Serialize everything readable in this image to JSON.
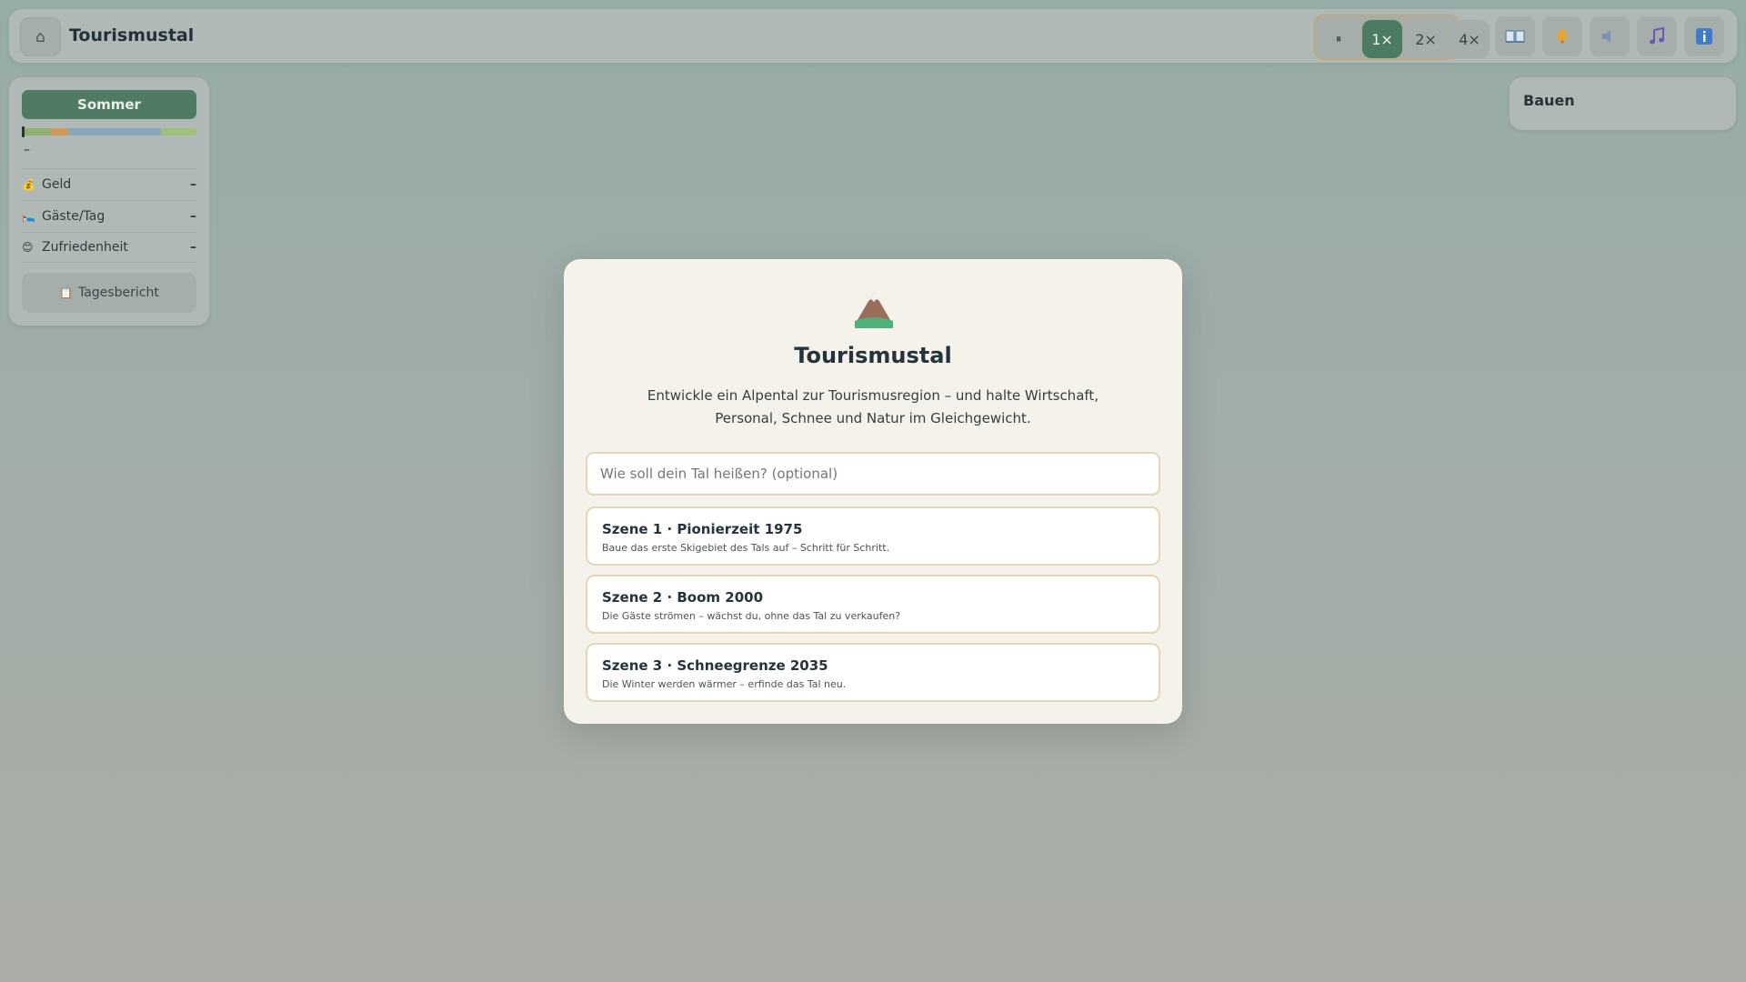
{
  "app": {
    "title": "Tourismustal",
    "home_icon": "⌂"
  },
  "controls": {
    "pause_label": "⏸",
    "speeds": [
      "1×",
      "2×",
      "4×"
    ],
    "active_speed": "1×",
    "tools": [
      {
        "name": "book-icon",
        "glyph": "📖"
      },
      {
        "name": "bell-icon",
        "glyph": "🔔"
      },
      {
        "name": "speaker-icon",
        "glyph": "🔈"
      },
      {
        "name": "music-icon",
        "glyph": "🎵"
      },
      {
        "name": "info-icon",
        "glyph": "ℹ"
      }
    ]
  },
  "sidebar": {
    "season": "Sommer",
    "date": "–",
    "stats": [
      {
        "icon": "💰",
        "label": "Geld",
        "value": "–"
      },
      {
        "icon": "🛌",
        "label": "Gäste/Tag",
        "value": "–"
      },
      {
        "icon": "😊",
        "label": "Zufriedenheit",
        "value": "–"
      }
    ],
    "report_icon": "📋",
    "report_label": "Tagesbericht",
    "season_bar_colors": [
      "#8fb070",
      "#d09a5a",
      "#8aa6be",
      "#9fbf7b"
    ]
  },
  "build_panel": {
    "title": "Bauen"
  },
  "modal": {
    "title": "Tourismustal",
    "description": "Entwickle ein Alpental zur Tourismusregion – und halte Wirtschaft, Personal, Schnee und Natur im Gleichgewicht.",
    "name_placeholder": "Wie soll dein Tal heißen? (optional)",
    "scenes": [
      {
        "title": "Szene 1 · Pionierzeit 1975",
        "desc": "Baue das erste Skigebiet des Tals auf – Schritt für Schritt."
      },
      {
        "title": "Szene 2 · Boom 2000",
        "desc": "Die Gäste strömen – wächst du, ohne das Tal zu verkaufen?"
      },
      {
        "title": "Szene 3 · Schneegrenze 2035",
        "desc": "Die Winter werden wärmer – erfinde das Tal neu."
      }
    ]
  },
  "colors": {
    "accent": "#4b7c63",
    "card_border": "#e3d6b8"
  }
}
